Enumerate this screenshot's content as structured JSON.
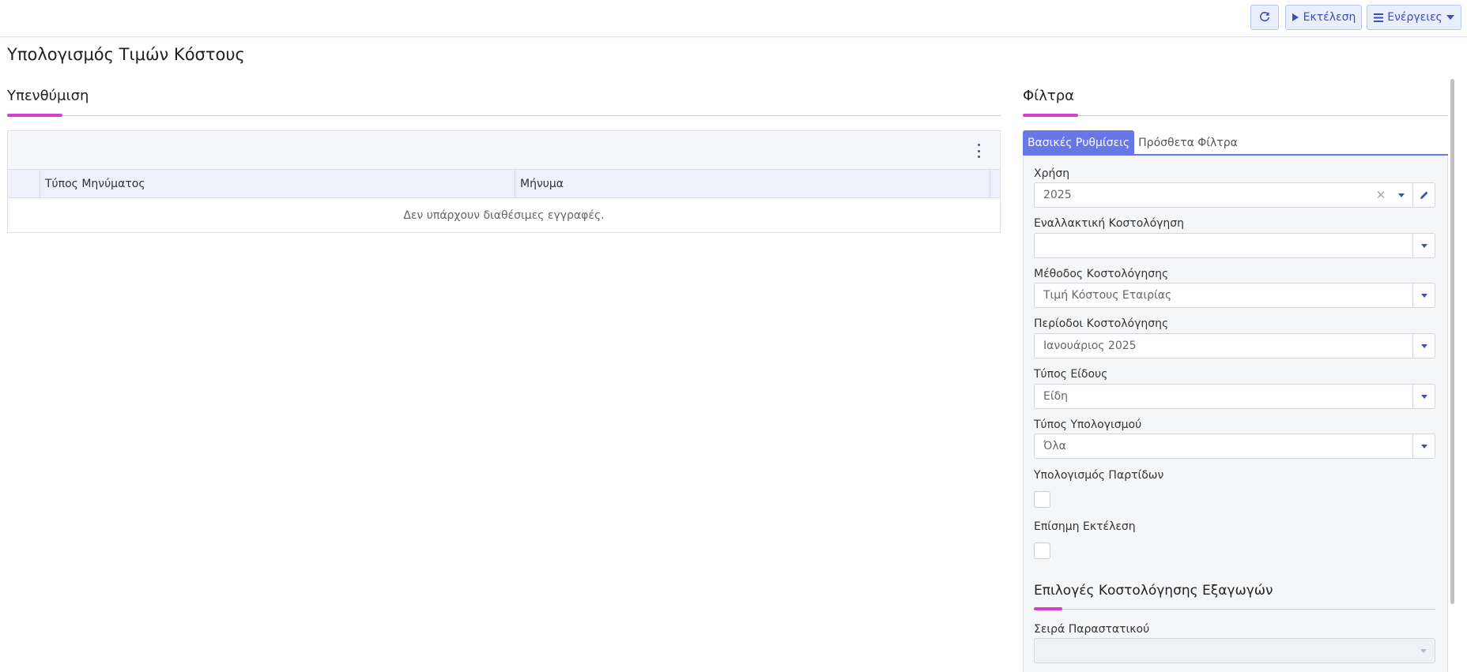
{
  "toolbar": {
    "refresh_icon": "refresh-icon",
    "run_label": "Εκτέλεση",
    "actions_label": "Ενέργειες"
  },
  "page": {
    "title": "Υπολογισμός Τιμών Κόστους"
  },
  "reminder": {
    "title": "Υπενθύμιση",
    "columns": [
      "Τύπος Μηνύματος",
      "Μήνυμα"
    ],
    "empty_text": "Δεν υπάρχουν διαθέσιμες εγγραφές."
  },
  "filters": {
    "title": "Φίλτρα",
    "tabs": [
      {
        "label": "Βασικές Ρυθμίσεις",
        "active": true
      },
      {
        "label": "Πρόσθετα Φίλτρα",
        "active": false
      }
    ],
    "fields": {
      "fiscal_year": {
        "label": "Χρήση",
        "value": "2025"
      },
      "alt_costing": {
        "label": "Εναλλακτική Κοστολόγηση",
        "value": ""
      },
      "costing_method": {
        "label": "Μέθοδος Κοστολόγησης",
        "value": "Τιμή Κόστους Εταιρίας"
      },
      "costing_periods": {
        "label": "Περίοδοι Κοστολόγησης",
        "value": "Ιανουάριος 2025"
      },
      "item_type": {
        "label": "Τύπος Είδους",
        "value": "Είδη"
      },
      "calc_type": {
        "label": "Τύπος Υπολογισμού",
        "value": "Όλα"
      },
      "batch_calc": {
        "label": "Υπολογισμός Παρτίδων",
        "checked": false
      },
      "official_run": {
        "label": "Επίσημη Εκτέλεση",
        "checked": false
      }
    },
    "export_section": {
      "title": "Επιλογές Κοστολόγησης Εξαγωγών",
      "series": {
        "label": "Σειρά Παραστατικού",
        "value": ""
      }
    }
  },
  "colors": {
    "accent": "#d63ed0",
    "primary": "#6777e8",
    "button_text": "#3f4db8"
  }
}
